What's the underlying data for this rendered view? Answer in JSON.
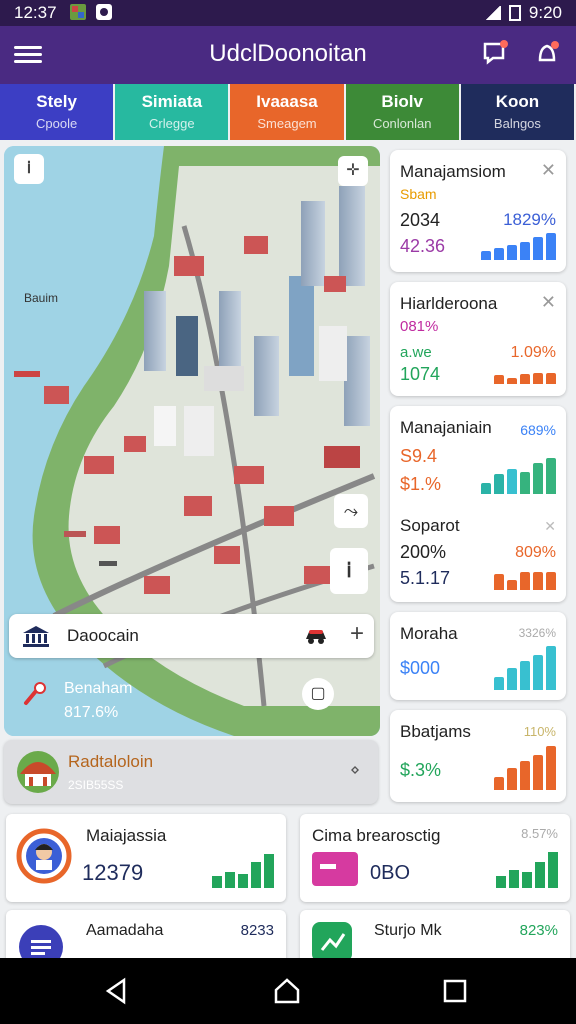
{
  "status": {
    "time": "12:37",
    "right_time": "9:20"
  },
  "app": {
    "title": "UdclDoonoitan"
  },
  "tabs": [
    {
      "label": "Stely",
      "sub": "Cpoole",
      "color": "#3c3ec4"
    },
    {
      "label": "Simiata",
      "sub": "Crlegge",
      "color": "#27b9a0"
    },
    {
      "label": "Ivaaasa",
      "sub": "Smeagem",
      "color": "#e8662a"
    },
    {
      "label": "Biolv",
      "sub": "Conlonlan",
      "color": "#3d8a37"
    },
    {
      "label": "Koon",
      "sub": "Balngos",
      "color": "#1f2c5c"
    }
  ],
  "map": {
    "place_label": "Bauim",
    "search_text": "Daoocain",
    "info_title": "Benaham",
    "info_value": "817.6%"
  },
  "feature_card": {
    "title": "Radtaloloin",
    "sub": "2SIB55SS"
  },
  "cards": [
    {
      "name": "Manajamsiom",
      "sub": "Sbam",
      "v1": "2034",
      "v2": "42.36",
      "pct": "1829%",
      "colors": [
        "#3b82f6",
        "#3b82f6",
        "#3b82f6",
        "#3b82f6",
        "#3b82f6",
        "#3b82f6"
      ],
      "heights": [
        0.3,
        0.4,
        0.5,
        0.6,
        0.75,
        0.9
      ]
    },
    {
      "name": "Hiarlderoona",
      "sub": "081%",
      "v1": "a.we",
      "v2": "1074",
      "pct": "1.09%",
      "colors": [
        "#e8662a",
        "#e8662a",
        "#e8662a",
        "#e8662a",
        "#e8662a"
      ],
      "heights": [
        0.5,
        0.35,
        0.55,
        0.6,
        0.6
      ]
    },
    {
      "name": "Manajaniain",
      "v1": "S9.4",
      "v2": "$1.%",
      "pct": "689%",
      "colors": [
        "#2bb3a7",
        "#2bb3a7",
        "#38c0d0",
        "#36b37e",
        "#36b37e",
        "#36b37e"
      ],
      "heights": [
        0.3,
        0.55,
        0.7,
        0.6,
        0.85,
        1.0
      ]
    },
    {
      "name": "Soparot",
      "v1": "200%",
      "v2": "5.1.17",
      "pct": "809%",
      "colors": [
        "#e8662a",
        "#e8662a",
        "#e8662a",
        "#e8662a",
        "#e8662a"
      ],
      "heights": [
        0.6,
        0.4,
        0.7,
        0.7,
        0.7
      ]
    },
    {
      "name": "Moraha",
      "v1": "$000",
      "pct": "3326%",
      "colors": [
        "#38c0d0",
        "#38c0d0",
        "#38c0d0",
        "#38c0d0",
        "#38c0d0"
      ],
      "heights": [
        0.3,
        0.5,
        0.65,
        0.8,
        1.0
      ]
    },
    {
      "name": "Bbatjams",
      "v1": "$.3%",
      "pct": "110%",
      "colors": [
        "#e8662a",
        "#e8662a",
        "#e8662a",
        "#e8662a",
        "#e8662a"
      ],
      "heights": [
        0.3,
        0.5,
        0.65,
        0.8,
        1.0
      ]
    }
  ],
  "bottom": [
    {
      "name": "Maiajassia",
      "value": "12379",
      "pct": "",
      "color": "#22a55b"
    },
    {
      "name": "Cima brearosctig",
      "value": "0BO",
      "pct": "8.57%",
      "color": "#22a55b"
    },
    {
      "name": "Aamadaha",
      "value": "",
      "pct": "8233",
      "color": "#1f2c5c"
    },
    {
      "name": "Sturjo Mk",
      "value": "",
      "pct": "823%",
      "color": "#22a55b"
    }
  ]
}
